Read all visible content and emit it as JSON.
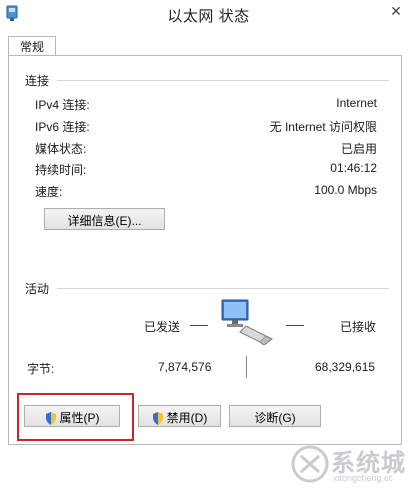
{
  "window": {
    "title": "以太网 状态",
    "close_glyph": "✕"
  },
  "tab": {
    "label": "常规"
  },
  "connection": {
    "heading": "连接",
    "rows": [
      {
        "label": "IPv4 连接:",
        "value": "Internet"
      },
      {
        "label": "IPv6 连接:",
        "value": "无 Internet 访问权限"
      },
      {
        "label": "媒体状态:",
        "value": "已启用"
      },
      {
        "label": "持续时间:",
        "value": "01:46:12"
      },
      {
        "label": "速度:",
        "value": "100.0 Mbps"
      }
    ],
    "details_button": "详细信息(E)..."
  },
  "activity": {
    "heading": "活动",
    "sent_label": "已发送",
    "received_label": "已接收",
    "bytes_label": "字节:",
    "bytes_sent": "7,874,576",
    "bytes_received": "68,329,615",
    "network_icon": "network-computer-icon"
  },
  "buttons": {
    "properties": "属性(P)",
    "disable": "禁用(D)",
    "diagnose": "诊断(G)"
  },
  "watermark": {
    "text": "系统城",
    "url": "xitongcheng.cc"
  },
  "colors": {
    "highlight": "#c9252c",
    "border": "#b9b9b9"
  }
}
